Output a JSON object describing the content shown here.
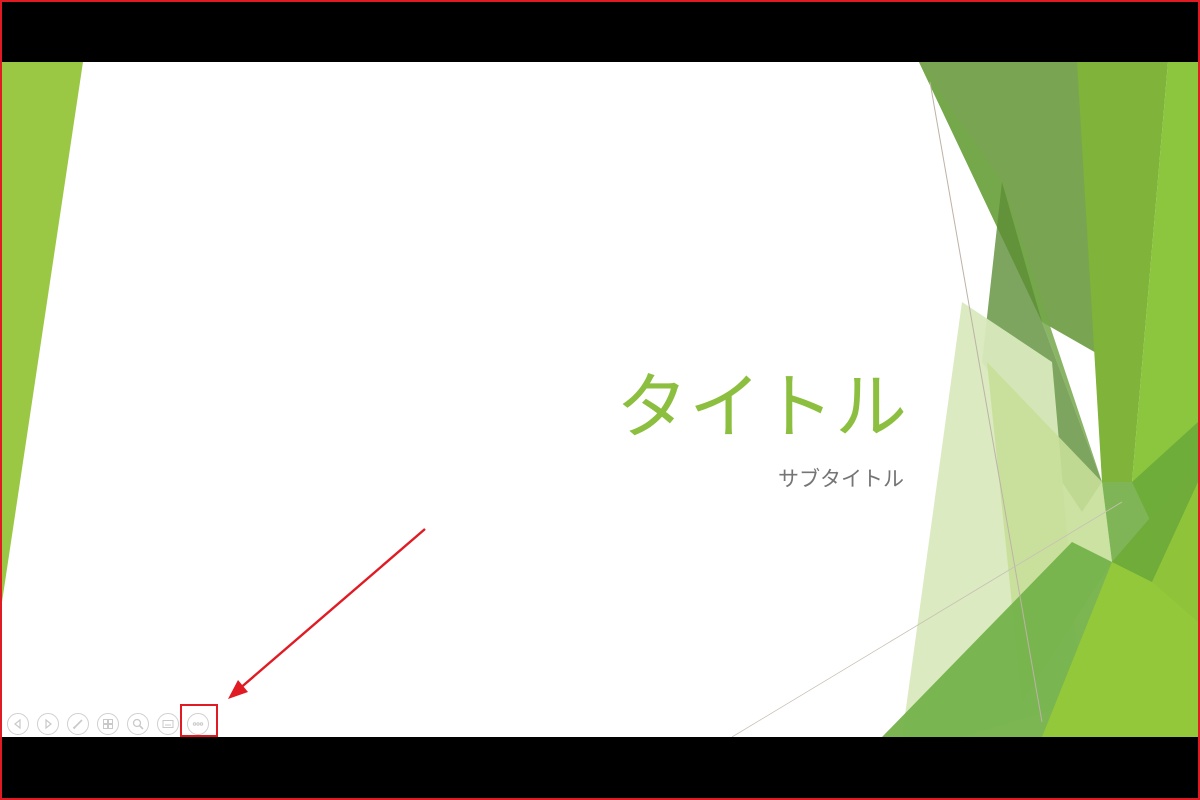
{
  "slide": {
    "title": "タイトル",
    "subtitle": "サブタイトル"
  },
  "controls": [
    {
      "name": "previous-button",
      "icon": "chevron-left-icon"
    },
    {
      "name": "next-button",
      "icon": "chevron-right-icon"
    },
    {
      "name": "pen-button",
      "icon": "pen-icon"
    },
    {
      "name": "slides-overview-button",
      "icon": "slides-grid-icon"
    },
    {
      "name": "zoom-button",
      "icon": "magnifier-icon"
    },
    {
      "name": "subtitles-button",
      "icon": "screen-icon"
    },
    {
      "name": "more-options-button",
      "icon": "ellipsis-icon"
    }
  ],
  "colors": {
    "annotation": "#e01b24",
    "title": "#8cbf3f",
    "subtitle": "#757575",
    "green_light": "#9bc844",
    "green_dark": "#6a9a3f"
  }
}
